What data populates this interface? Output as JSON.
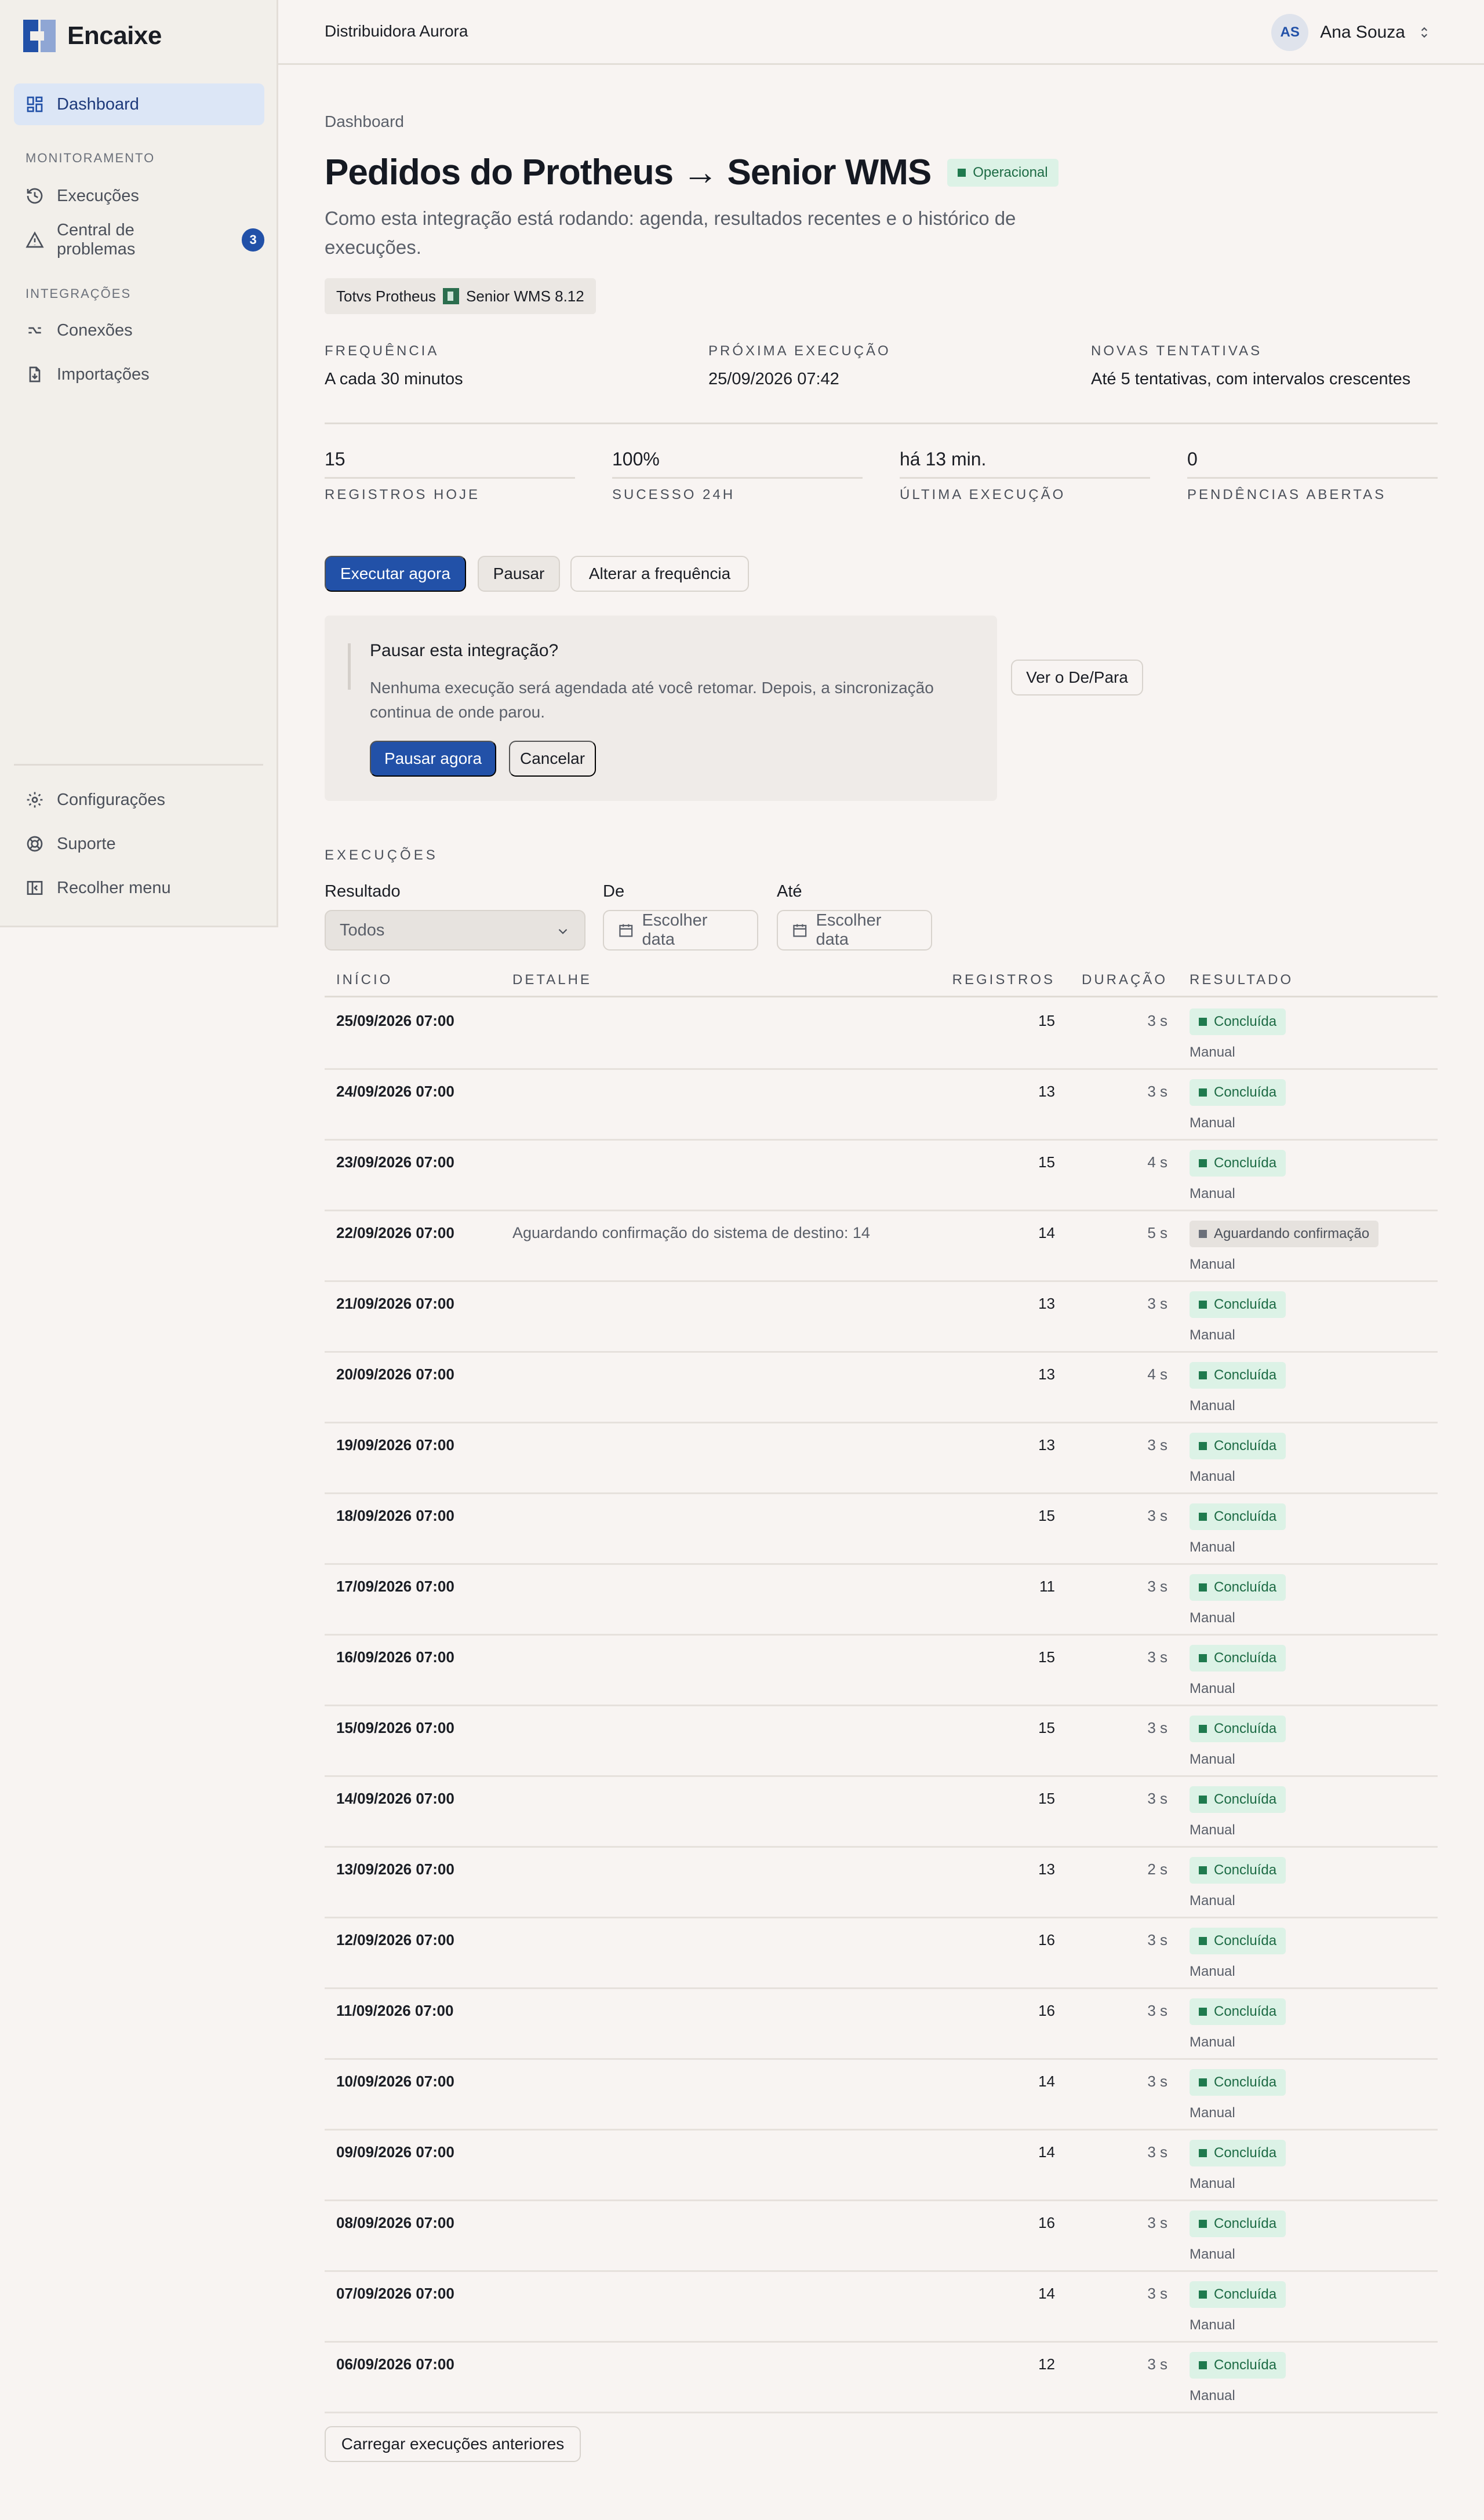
{
  "brand": {
    "name": "Encaixe"
  },
  "sidebar": {
    "dashboard": "Dashboard",
    "section_monitoring": "MONITORAMENTO",
    "executions": "Execuções",
    "problems": "Central de problemas",
    "problems_count": "3",
    "section_integrations": "INTEGRAÇÕES",
    "connections": "Conexões",
    "imports": "Importações",
    "settings": "Configurações",
    "support": "Suporte",
    "collapse": "Recolher menu"
  },
  "header": {
    "org": "Distribuidora Aurora",
    "user_initials": "AS",
    "user_name": "Ana Souza"
  },
  "page": {
    "breadcrumb": "Dashboard",
    "title": "Pedidos do Protheus → Senior WMS",
    "status": "Operacional",
    "subtitle": "Como esta integração está rodando: agenda, resultados recentes e o histórico de execuções.",
    "source_system": "Totvs Protheus",
    "target_system": "Senior WMS 8.12"
  },
  "meta": {
    "frequency_label": "FREQUÊNCIA",
    "frequency_value": "A cada 30 minutos",
    "next_label": "PRÓXIMA EXECUÇÃO",
    "next_value": "25/09/2026 07:42",
    "retries_label": "NOVAS TENTATIVAS",
    "retries_value": "Até 5 tentativas, com intervalos crescentes"
  },
  "stats": {
    "records_value": "15",
    "records_label": "REGISTROS HOJE",
    "success_value": "100%",
    "success_label": "SUCESSO 24H",
    "last_value": "há 13 min.",
    "last_label": "ÚLTIMA EXECUÇÃO",
    "pending_value": "0",
    "pending_label": "PENDÊNCIAS ABERTAS"
  },
  "actions": {
    "run_now": "Executar agora",
    "pause": "Pausar",
    "change_freq": "Alterar a frequência",
    "view_mapping": "Ver o De/Para"
  },
  "pause_panel": {
    "title": "Pausar esta integração?",
    "text": "Nenhuma execução será agendada até você retomar. Depois, a sincronização continua de onde parou.",
    "confirm": "Pausar agora",
    "cancel": "Cancelar"
  },
  "executions": {
    "section_title": "EXECUÇÕES",
    "filter_result_label": "Resultado",
    "filter_result_value": "Todos",
    "filter_from_label": "De",
    "filter_to_label": "Até",
    "date_placeholder": "Escolher data",
    "columns": {
      "start": "INÍCIO",
      "detail": "DETALHE",
      "records": "REGISTROS",
      "duration": "DURAÇÃO",
      "result": "RESULTADO"
    },
    "rows": [
      {
        "start": "25/09/2026 07:00",
        "detail": "",
        "records": "15",
        "duration": "3 s",
        "result": "Concluída",
        "status": "ok",
        "source": "Manual"
      },
      {
        "start": "24/09/2026 07:00",
        "detail": "",
        "records": "13",
        "duration": "3 s",
        "result": "Concluída",
        "status": "ok",
        "source": "Manual"
      },
      {
        "start": "23/09/2026 07:00",
        "detail": "",
        "records": "15",
        "duration": "4 s",
        "result": "Concluída",
        "status": "ok",
        "source": "Manual"
      },
      {
        "start": "22/09/2026 07:00",
        "detail": "Aguardando confirmação do sistema de destino: 14",
        "records": "14",
        "duration": "5 s",
        "result": "Aguardando confirmação",
        "status": "wait",
        "source": "Manual"
      },
      {
        "start": "21/09/2026 07:00",
        "detail": "",
        "records": "13",
        "duration": "3 s",
        "result": "Concluída",
        "status": "ok",
        "source": "Manual"
      },
      {
        "start": "20/09/2026 07:00",
        "detail": "",
        "records": "13",
        "duration": "4 s",
        "result": "Concluída",
        "status": "ok",
        "source": "Manual"
      },
      {
        "start": "19/09/2026 07:00",
        "detail": "",
        "records": "13",
        "duration": "3 s",
        "result": "Concluída",
        "status": "ok",
        "source": "Manual"
      },
      {
        "start": "18/09/2026 07:00",
        "detail": "",
        "records": "15",
        "duration": "3 s",
        "result": "Concluída",
        "status": "ok",
        "source": "Manual"
      },
      {
        "start": "17/09/2026 07:00",
        "detail": "",
        "records": "11",
        "duration": "3 s",
        "result": "Concluída",
        "status": "ok",
        "source": "Manual"
      },
      {
        "start": "16/09/2026 07:00",
        "detail": "",
        "records": "15",
        "duration": "3 s",
        "result": "Concluída",
        "status": "ok",
        "source": "Manual"
      },
      {
        "start": "15/09/2026 07:00",
        "detail": "",
        "records": "15",
        "duration": "3 s",
        "result": "Concluída",
        "status": "ok",
        "source": "Manual"
      },
      {
        "start": "14/09/2026 07:00",
        "detail": "",
        "records": "15",
        "duration": "3 s",
        "result": "Concluída",
        "status": "ok",
        "source": "Manual"
      },
      {
        "start": "13/09/2026 07:00",
        "detail": "",
        "records": "13",
        "duration": "2 s",
        "result": "Concluída",
        "status": "ok",
        "source": "Manual"
      },
      {
        "start": "12/09/2026 07:00",
        "detail": "",
        "records": "16",
        "duration": "3 s",
        "result": "Concluída",
        "status": "ok",
        "source": "Manual"
      },
      {
        "start": "11/09/2026 07:00",
        "detail": "",
        "records": "16",
        "duration": "3 s",
        "result": "Concluída",
        "status": "ok",
        "source": "Manual"
      },
      {
        "start": "10/09/2026 07:00",
        "detail": "",
        "records": "14",
        "duration": "3 s",
        "result": "Concluída",
        "status": "ok",
        "source": "Manual"
      },
      {
        "start": "09/09/2026 07:00",
        "detail": "",
        "records": "14",
        "duration": "3 s",
        "result": "Concluída",
        "status": "ok",
        "source": "Manual"
      },
      {
        "start": "08/09/2026 07:00",
        "detail": "",
        "records": "16",
        "duration": "3 s",
        "result": "Concluída",
        "status": "ok",
        "source": "Manual"
      },
      {
        "start": "07/09/2026 07:00",
        "detail": "",
        "records": "14",
        "duration": "3 s",
        "result": "Concluída",
        "status": "ok",
        "source": "Manual"
      },
      {
        "start": "06/09/2026 07:00",
        "detail": "",
        "records": "12",
        "duration": "3 s",
        "result": "Concluída",
        "status": "ok",
        "source": "Manual"
      }
    ],
    "load_more": "Carregar execuções anteriores"
  }
}
